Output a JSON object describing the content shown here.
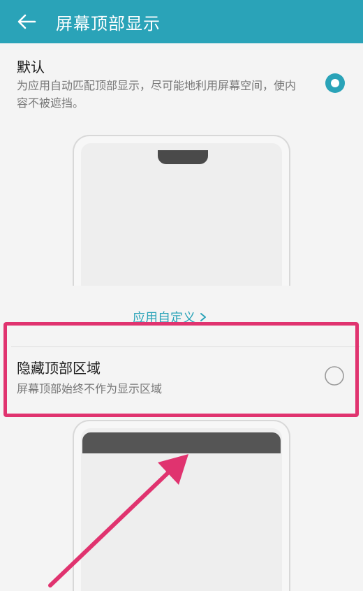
{
  "app_bar": {
    "title": "屏幕顶部显示",
    "back_icon": "arrow-left-icon"
  },
  "options": {
    "default": {
      "title": "默认",
      "description": "为应用自动匹配顶部显示，尽可能地利用屏幕空间，使内容不被遮挡。",
      "selected": true
    },
    "custom_link": "应用自定义",
    "hide_top": {
      "title": "隐藏顶部区域",
      "description": "屏幕顶部始终不作为显示区域",
      "selected": false
    }
  },
  "colors": {
    "app_bar": "#2aa3b8",
    "accent": "#2aa3b8",
    "highlight": "#e0336f",
    "background": "#f4f4f4"
  },
  "icons": {
    "radio_checked": "radio-checked-icon",
    "radio_unchecked": "radio-unchecked-icon",
    "chevron": "chevron-right-icon",
    "annotation_arrow": "annotation-arrow-icon"
  }
}
